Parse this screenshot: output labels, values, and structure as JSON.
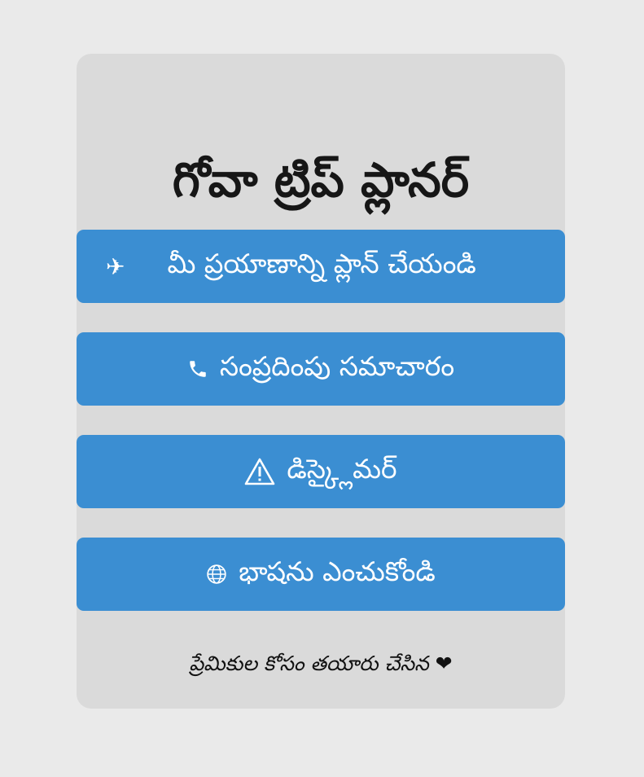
{
  "app": {
    "title": "గోవా ట్రిప్ ప్లానర్"
  },
  "menu": {
    "plan": {
      "icon": "airplane-icon",
      "label": "మీ ప్రయాణాన్ని ప్లాన్ చేయండి"
    },
    "contact": {
      "icon": "phone-icon",
      "label": "సంప్రదింపు సమాచారం"
    },
    "disclaimer": {
      "icon": "warning-icon",
      "label": "డిస్క్లైమర్"
    },
    "language": {
      "icon": "globe-icon",
      "label": "భాషను ఎంచుకోండి"
    }
  },
  "footer": {
    "text": "ప్రేమికుల కోసం తయారు చేసిన",
    "icon": "heart-icon"
  },
  "colors": {
    "page_background": "#eaeaea",
    "card_background": "#dadada",
    "button_background": "#3b8ed2",
    "button_text": "#ffffff",
    "title_text": "#161616"
  }
}
